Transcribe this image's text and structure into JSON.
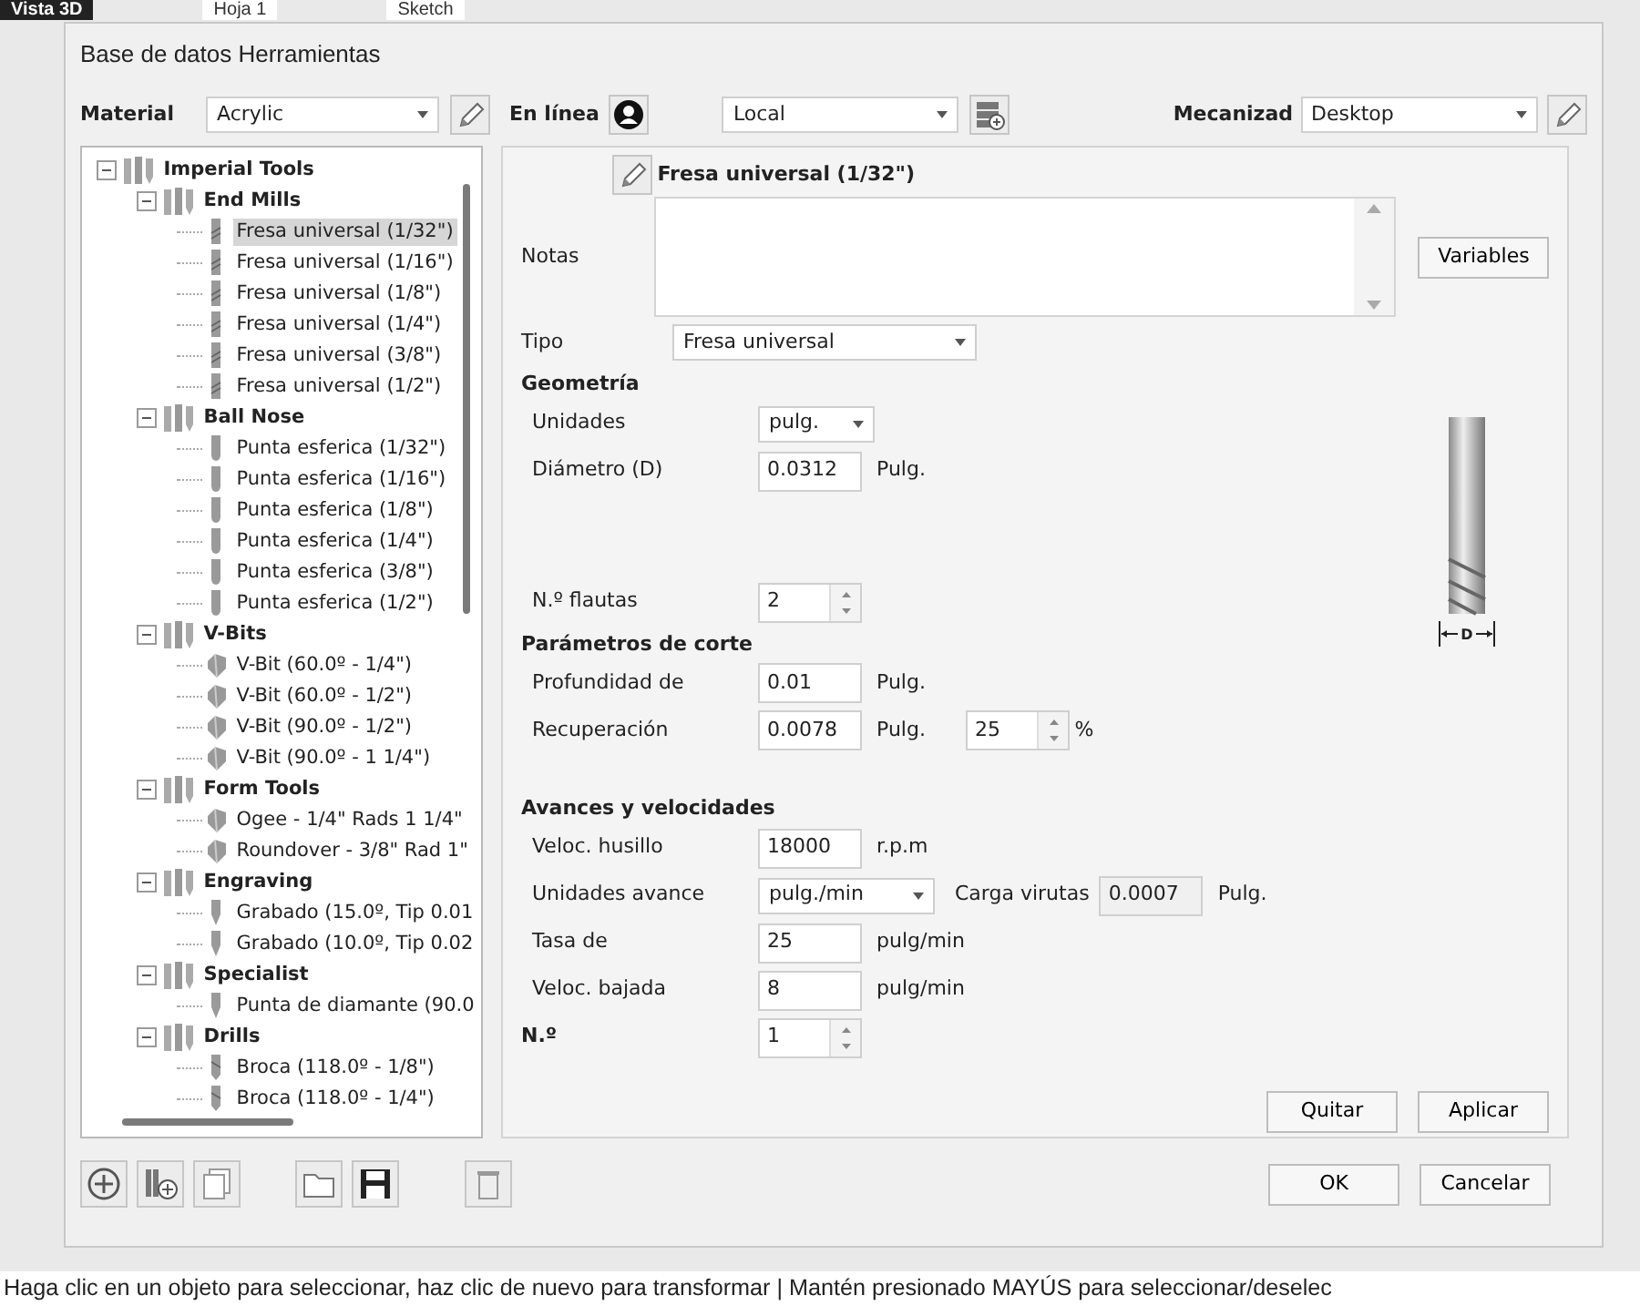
{
  "background": {
    "tabs": [
      {
        "label": "Vista 3D",
        "selected": true
      },
      {
        "label": "Hoja 1",
        "selected": false
      },
      {
        "label": "Sketch",
        "selected": false
      }
    ]
  },
  "dialog": {
    "title": "Base de datos Herramientas",
    "toolbar": {
      "material": {
        "label": "Material",
        "value": "Acrylic"
      },
      "online": {
        "label": "En línea"
      },
      "source": {
        "value": "Local"
      },
      "machine": {
        "label": "Mecanizad",
        "value": "Desktop"
      }
    },
    "tree": [
      {
        "label": "Imperial Tools",
        "expanded": true,
        "children": [
          {
            "label": "End Mills",
            "expanded": true,
            "children": [
              {
                "label": "Fresa universal (1/32\")",
                "kind": "endmill",
                "selected": true
              },
              {
                "label": "Fresa universal (1/16\")",
                "kind": "endmill",
                "selected": false
              },
              {
                "label": "Fresa universal (1/8\")",
                "kind": "endmill",
                "selected": false
              },
              {
                "label": "Fresa universal (1/4\")",
                "kind": "endmill",
                "selected": false
              },
              {
                "label": "Fresa universal (3/8\")",
                "kind": "endmill",
                "selected": false
              },
              {
                "label": "Fresa universal (1/2\")",
                "kind": "endmill",
                "selected": false
              }
            ]
          },
          {
            "label": "Ball Nose",
            "expanded": true,
            "children": [
              {
                "label": "Punta esferica (1/32\")",
                "kind": "ballnose",
                "selected": false
              },
              {
                "label": "Punta esferica (1/16\")",
                "kind": "ballnose",
                "selected": false
              },
              {
                "label": "Punta esferica (1/8\")",
                "kind": "ballnose",
                "selected": false
              },
              {
                "label": "Punta esferica (1/4\")",
                "kind": "ballnose",
                "selected": false
              },
              {
                "label": "Punta esferica (3/8\")",
                "kind": "ballnose",
                "selected": false
              },
              {
                "label": "Punta esferica (1/2\")",
                "kind": "ballnose",
                "selected": false
              }
            ]
          },
          {
            "label": "V-Bits",
            "expanded": true,
            "children": [
              {
                "label": "V-Bit (60.0º - 1/4\")",
                "kind": "vbit",
                "selected": false
              },
              {
                "label": "V-Bit (60.0º - 1/2\")",
                "kind": "vbit",
                "selected": false
              },
              {
                "label": "V-Bit (90.0º - 1/2\")",
                "kind": "vbit",
                "selected": false
              },
              {
                "label": "V-Bit (90.0º - 1 1/4\")",
                "kind": "vbit",
                "selected": false
              }
            ]
          },
          {
            "label": "Form Tools",
            "expanded": true,
            "children": [
              {
                "label": "Ogee - 1/4\" Rads 1 1/4\"",
                "kind": "vbit",
                "selected": false
              },
              {
                "label": "Roundover - 3/8\" Rad 1\"",
                "kind": "vbit",
                "selected": false
              }
            ]
          },
          {
            "label": "Engraving",
            "expanded": true,
            "children": [
              {
                "label": "Grabado (15.0º, Tip 0.01",
                "kind": "engraving",
                "selected": false
              },
              {
                "label": "Grabado (10.0º, Tip 0.02",
                "kind": "engraving",
                "selected": false
              }
            ]
          },
          {
            "label": "Specialist",
            "expanded": true,
            "children": [
              {
                "label": "Punta de diamante (90.0",
                "kind": "engraving",
                "selected": false
              }
            ]
          },
          {
            "label": "Drills",
            "expanded": true,
            "children": [
              {
                "label": "Broca (118.0º - 1/8\")",
                "kind": "drill",
                "selected": false
              },
              {
                "label": "Broca (118.0º - 1/4\")",
                "kind": "drill",
                "selected": false
              }
            ]
          }
        ]
      }
    ],
    "editor": {
      "title": "Fresa universal (1/32\")",
      "notes": {
        "label": "Notas"
      },
      "variables_button": "Variables",
      "type": {
        "label": "Tipo",
        "value": "Fresa universal"
      },
      "sections": [
        {
          "title": "Geometría",
          "fields": [
            {
              "kind": "select",
              "label": "Unidades",
              "value": "pulg."
            },
            {
              "kind": "input",
              "label": "Diámetro (D)",
              "value": "0.0312",
              "unit": "Pulg."
            },
            {
              "kind": "spin",
              "label": "N.º flautas",
              "value": "2"
            }
          ]
        },
        {
          "title": "Parámetros de corte",
          "fields": [
            {
              "kind": "input",
              "label": "Profundidad de",
              "value": "0.01",
              "unit": "Pulg."
            },
            {
              "kind": "input",
              "label": "Recuperación",
              "value": "0.0078",
              "unit": "Pulg.",
              "percent": "25",
              "percent_unit": "%"
            }
          ]
        },
        {
          "title": "Avances y velocidades",
          "fields": [
            {
              "kind": "input",
              "label": "Veloc. husillo",
              "value": "18000",
              "unit": "r.p.m"
            },
            {
              "kind": "select",
              "label": "Unidades avance",
              "value": "pulg./min",
              "chip_load": {
                "label": "Carga virutas",
                "value": "0.0007",
                "unit": "Pulg."
              }
            },
            {
              "kind": "input",
              "label": "Tasa de",
              "value": "25",
              "unit": "pulg/min"
            },
            {
              "kind": "input",
              "label": "Veloc. bajada",
              "value": "8",
              "unit": "pulg/min"
            }
          ]
        }
      ],
      "number": {
        "label": "N.º",
        "value": "1"
      },
      "diagram_label": "D",
      "buttons": [
        "Quitar",
        "Aplicar"
      ]
    },
    "footer_buttons": [
      "OK",
      "Cancelar"
    ]
  },
  "status_bar": "Haga clic en un objeto para seleccionar, haz clic de nuevo para transformar | Mantén presionado MAYÚS para seleccionar/deselec"
}
